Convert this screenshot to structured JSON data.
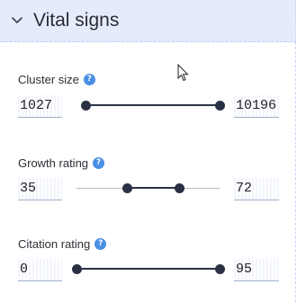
{
  "header": {
    "title": "Vital signs",
    "toggle_icon": "chevron-down-icon"
  },
  "filters": [
    {
      "label": "Cluster size",
      "help_icon": "help-icon",
      "min_value": "1027",
      "max_value": "10196",
      "range_fraction": [
        0.03,
        1.0
      ]
    },
    {
      "label": "Growth rating",
      "help_icon": "help-icon",
      "min_value": "35",
      "max_value": "72",
      "range_fraction": [
        0.35,
        0.72
      ]
    },
    {
      "label": "Citation rating",
      "help_icon": "help-icon",
      "min_value": "0",
      "max_value": "95",
      "range_fraction": [
        0.0,
        1.0
      ]
    }
  ],
  "colors": {
    "header_bg": "#e4ecfb",
    "slider_active": "#2b3145",
    "slider_track": "#b5bcc7",
    "help_badge": "#4a8fe3"
  }
}
